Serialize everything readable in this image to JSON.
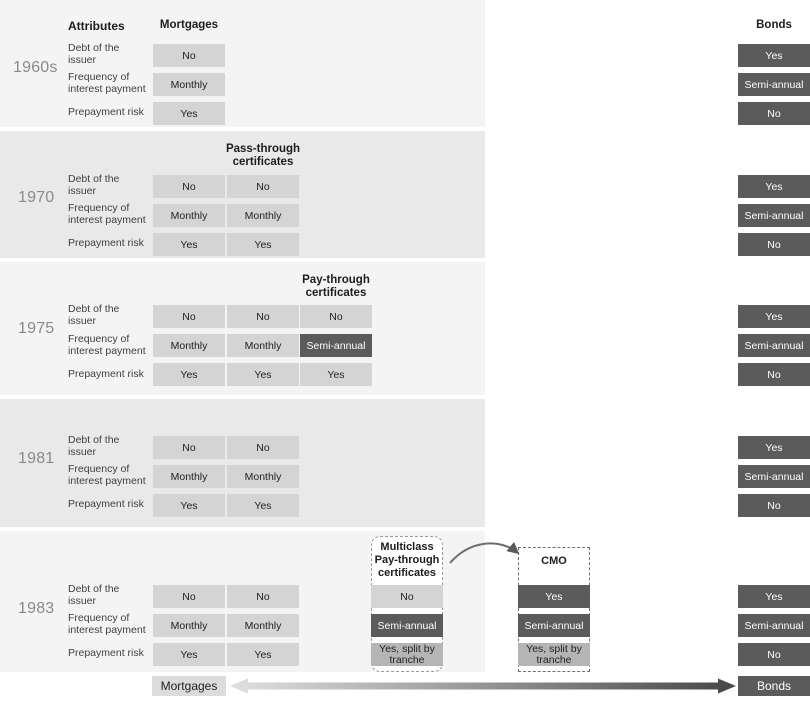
{
  "diagram": {
    "title_attributes": "Attributes",
    "axis": {
      "left_label": "Mortgages",
      "right_label": "Bonds"
    },
    "column_headers": {
      "mortgages": "Mortgages",
      "pass_through": "Pass-through\ncertificates",
      "pay_through": "Pay-through\ncertificates",
      "bonds": "Bonds",
      "multiclass": "Multiclass\nPay-through\ncertificates",
      "cmo": "CMO"
    },
    "attributes": [
      "Debt of the\nissuer",
      "Frequency of\ninterest payment",
      "Prepayment risk"
    ],
    "eras": [
      {
        "label": "1960s",
        "columns": [
          {
            "key": "mortgages",
            "values": [
              "No",
              "Monthly",
              "Yes"
            ],
            "styles": [
              "light",
              "light",
              "light"
            ]
          }
        ],
        "bonds": [
          "Yes",
          "Semi-annual",
          "No"
        ]
      },
      {
        "label": "1970",
        "columns": [
          {
            "key": "mortgages",
            "values": [
              "No",
              "Monthly",
              "Yes"
            ],
            "styles": [
              "light",
              "light",
              "light"
            ]
          },
          {
            "key": "pass_through",
            "values": [
              "No",
              "Monthly",
              "Yes"
            ],
            "styles": [
              "light",
              "light",
              "light"
            ]
          }
        ],
        "bonds": [
          "Yes",
          "Semi-annual",
          "No"
        ]
      },
      {
        "label": "1975",
        "columns": [
          {
            "key": "mortgages",
            "values": [
              "No",
              "Monthly",
              "Yes"
            ],
            "styles": [
              "light",
              "light",
              "light"
            ]
          },
          {
            "key": "pass_through",
            "values": [
              "No",
              "Monthly",
              "Yes"
            ],
            "styles": [
              "light",
              "light",
              "light"
            ]
          },
          {
            "key": "pay_through",
            "values": [
              "No",
              "Semi-annual",
              "Yes"
            ],
            "styles": [
              "light",
              "dark",
              "light"
            ]
          }
        ],
        "bonds": [
          "Yes",
          "Semi-annual",
          "No"
        ]
      },
      {
        "label": "1981",
        "columns": [
          {
            "key": "mortgages",
            "values": [
              "No",
              "Monthly",
              "Yes"
            ],
            "styles": [
              "light",
              "light",
              "light"
            ]
          },
          {
            "key": "pass_through",
            "values": [
              "No",
              "Monthly",
              "Yes"
            ],
            "styles": [
              "light",
              "light",
              "light"
            ]
          }
        ],
        "bonds": [
          "Yes",
          "Semi-annual",
          "No"
        ]
      },
      {
        "label": "1983",
        "columns": [
          {
            "key": "mortgages",
            "values": [
              "No",
              "Monthly",
              "Yes"
            ],
            "styles": [
              "light",
              "light",
              "light"
            ]
          },
          {
            "key": "pass_through",
            "values": [
              "No",
              "Monthly",
              "Yes"
            ],
            "styles": [
              "light",
              "light",
              "light"
            ]
          }
        ],
        "bonds": [
          "Yes",
          "Semi-annual",
          "No"
        ]
      }
    ],
    "callouts": {
      "multiclass": {
        "title": "Multiclass\nPay-through\ncertificates",
        "values": [
          "No",
          "Semi-annual",
          "Yes, split by\ntranche"
        ],
        "styles": [
          "light",
          "dark",
          "mid"
        ]
      },
      "cmo": {
        "title": "CMO",
        "values": [
          "Yes",
          "Semi-annual",
          "Yes, split by\ntranche"
        ],
        "styles": [
          "dark",
          "dark",
          "mid"
        ]
      }
    },
    "colors": {
      "band_light": "#f4f4f4",
      "band_dark": "#e9e9e9",
      "cell_light": "#d4d4d4",
      "cell_mid": "#b5b5b5",
      "cell_dark": "#5b5b5b",
      "era_text": "#8a8a8a"
    }
  }
}
